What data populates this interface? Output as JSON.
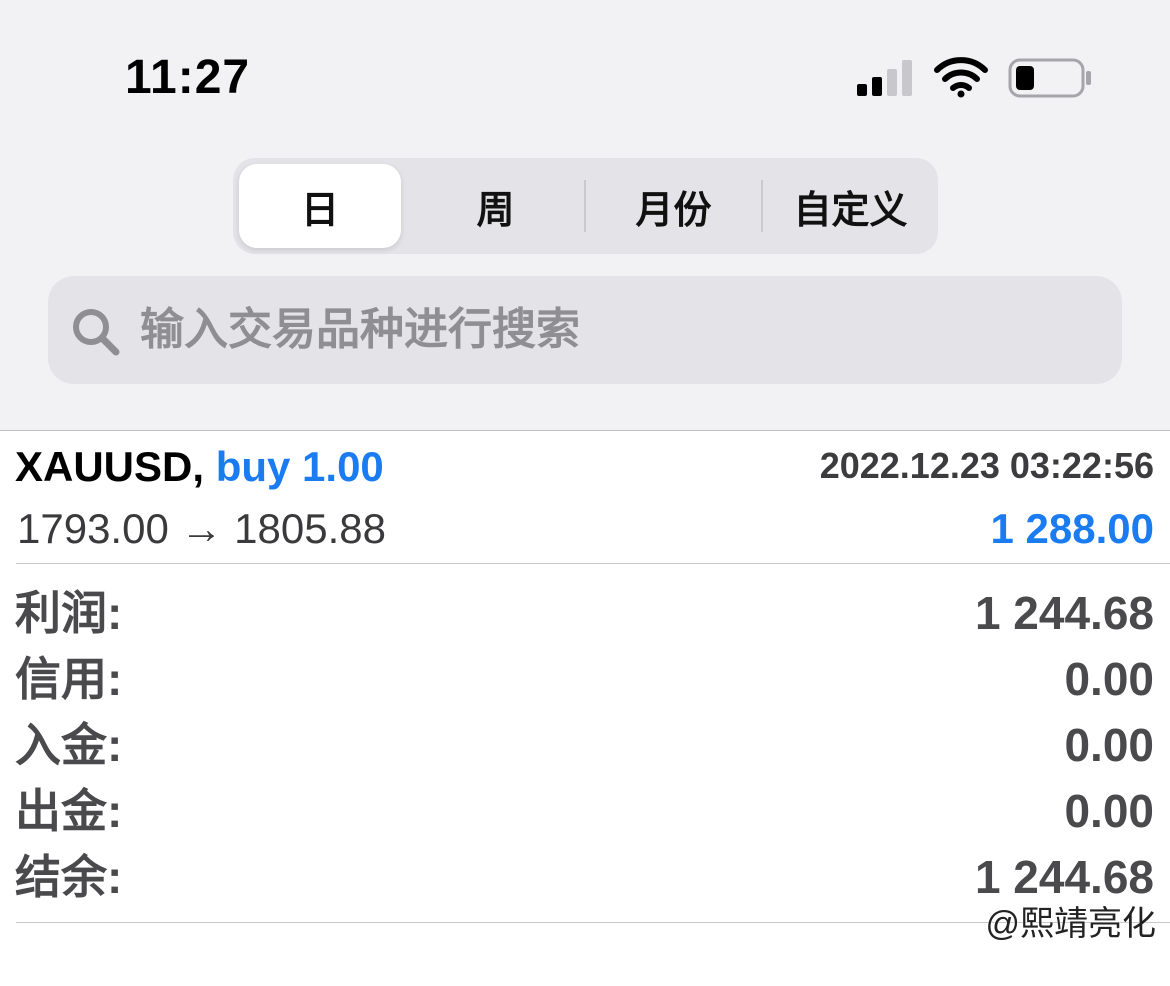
{
  "status_bar": {
    "time": "11:27",
    "icons": [
      "cellular-signal-icon",
      "wifi-icon",
      "battery-icon"
    ]
  },
  "period_tabs": {
    "items": [
      {
        "label": "日",
        "selected": true
      },
      {
        "label": "周",
        "selected": false
      },
      {
        "label": "月份",
        "selected": false
      },
      {
        "label": "自定义",
        "selected": false
      }
    ]
  },
  "search": {
    "placeholder": "输入交易品种进行搜索"
  },
  "trade": {
    "symbol": "XAUUSD,",
    "side": "buy 1.00",
    "time": "2022.12.23 03:22:56",
    "prices": "1793.00 → 1805.88",
    "profit": "1 288.00"
  },
  "summary": [
    {
      "label": "利润:",
      "value": "1 244.68"
    },
    {
      "label": "信用:",
      "value": "0.00"
    },
    {
      "label": "入金:",
      "value": "0.00"
    },
    {
      "label": "出金:",
      "value": "0.00"
    },
    {
      "label": "结余:",
      "value": "1 244.68"
    }
  ],
  "watermark": "@熙靖亮化",
  "colors": {
    "accent": "#1b7cf2",
    "header_bg": "#f2f2f4",
    "control_bg": "#e4e4e8",
    "label_gray": "#4a4a4c"
  }
}
